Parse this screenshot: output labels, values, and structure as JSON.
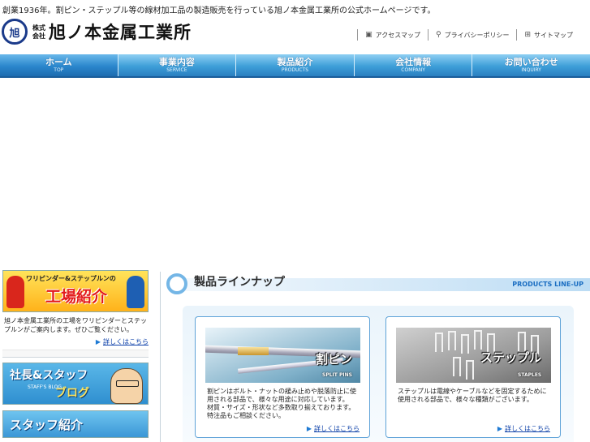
{
  "header": {
    "tagline": "創業1936年。割ピン・ステップル等の線材加工品の製造販売を行っている旭ノ本金属工業所の公式ホームページです。",
    "logo": {
      "mark": "旭",
      "sub_line1": "株式",
      "sub_line2": "会社",
      "name": "旭ノ本金属工業所"
    },
    "links": [
      {
        "label": "アクセスマップ",
        "icon": "map-icon"
      },
      {
        "label": "プライバシーポリシー",
        "icon": "search-icon"
      },
      {
        "label": "サイトマップ",
        "icon": "sitemap-icon"
      }
    ]
  },
  "nav": [
    {
      "jp": "ホーム",
      "en": "TOP"
    },
    {
      "jp": "事業内容",
      "en": "SERVICE"
    },
    {
      "jp": "製品紹介",
      "en": "PRODUCTS"
    },
    {
      "jp": "会社情報",
      "en": "COMPANY"
    },
    {
      "jp": "お問い合わせ",
      "en": "INQUIRY"
    }
  ],
  "sidebar": {
    "factory_banner": {
      "top": "ワリピンダー&ステップルンの",
      "main": "工場紹介"
    },
    "factory_text": "旭ノ本金属工業所の工場をワリピンダーとステップルンがご案内します。ぜひご覧ください。",
    "more_label": "詳しくはこちら",
    "blog_banner": {
      "main1": "社長&スタッフ",
      "small": "STAFF'S BLOG",
      "main2": "ブログ"
    },
    "staff_banner": {
      "main": "スタッフ紹介"
    }
  },
  "main": {
    "title_jp": "製品ラインナップ",
    "title_en": "PRODUCTS LINE-UP",
    "products": [
      {
        "label": "割ピン",
        "label_en": "SPLIT PINS",
        "text1": "割ピンはボルト・ナットの緩み止めや脱落防止に使用される部品で、様々な用途に対応しています。",
        "text2": "材質・サイズ・形状など多数取り揃えております。特注品もご相談ください。",
        "more": "詳しくはこちら"
      },
      {
        "label": "ステップル",
        "label_en": "STAPLES",
        "text1": "ステップルは電線やケーブルなどを固定するために使用される部品で、様々な種類がございます。",
        "text2": "",
        "more": "詳しくはこちら"
      }
    ]
  },
  "colors": {
    "nav_top": "#8fcff3",
    "nav_bottom": "#2a7fc0",
    "link_blue": "#0b3fa8",
    "accent_blue": "#1b6ec2"
  }
}
